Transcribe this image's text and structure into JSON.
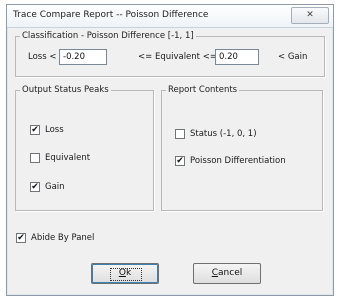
{
  "window": {
    "title": "Trace Compare Report -- Poisson Difference",
    "close_glyph": "✕"
  },
  "classification": {
    "legend": "Classification - Poisson Difference [-1, 1]",
    "loss_label": "Loss <",
    "loss_value": "-0.20",
    "equivalent_label": "<= Equivalent <=",
    "gain_value": "0.20",
    "gain_label": "< Gain"
  },
  "output_status": {
    "legend": "Output Status Peaks",
    "items": [
      {
        "label": "Loss",
        "checked": true,
        "mark": "✔"
      },
      {
        "label": "Equivalent",
        "checked": false,
        "mark": ""
      },
      {
        "label": "Gain",
        "checked": true,
        "mark": "✔"
      }
    ]
  },
  "report_contents": {
    "legend": "Report Contents",
    "items": [
      {
        "label": "Status (-1, 0, 1)",
        "checked": false,
        "mark": ""
      },
      {
        "label": "Poisson Differentiation",
        "checked": true,
        "mark": "✔"
      }
    ]
  },
  "abide": {
    "label": "Abide By Panel",
    "checked": true,
    "mark": "✔"
  },
  "buttons": {
    "ok_accel": "O",
    "ok_rest": "k",
    "cancel_accel": "C",
    "cancel_rest": "ancel"
  }
}
